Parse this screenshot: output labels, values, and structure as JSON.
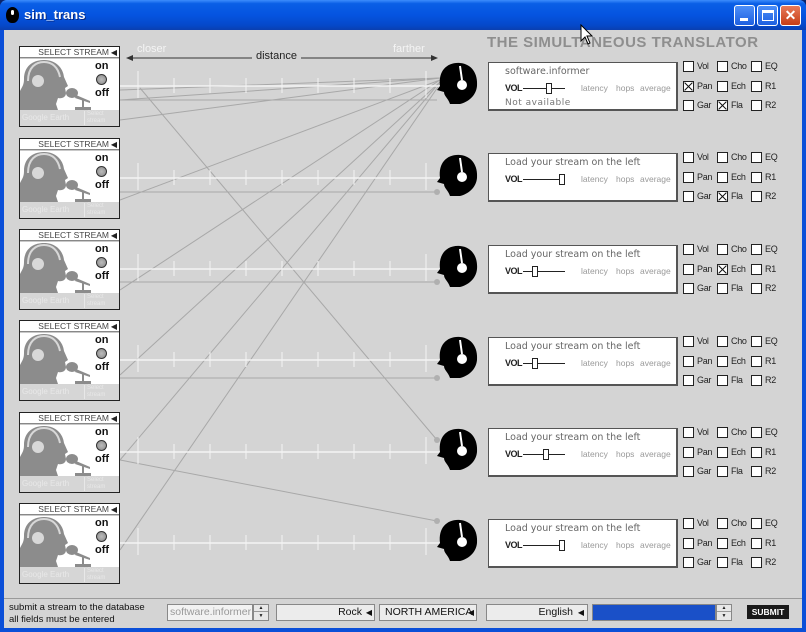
{
  "window": {
    "title": "sim_trans",
    "icon": "headphones-head-icon",
    "controls": [
      "minimize",
      "maximize",
      "close"
    ]
  },
  "header": {
    "brand": "THE SIMULTANEOUS TRANSLATOR",
    "distance_label": "distance",
    "closer_label": "closer",
    "farther_label": "farther"
  },
  "streams": [
    {
      "select_label": "SELECT STREAM",
      "on_label": "on",
      "off_label": "off",
      "footer_label": "Google Earth",
      "footer_sub": "Select stream"
    },
    {
      "select_label": "SELECT STREAM",
      "on_label": "on",
      "off_label": "off",
      "footer_label": "Google Earth",
      "footer_sub": "Select stream"
    },
    {
      "select_label": "SELECT STREAM",
      "on_label": "on",
      "off_label": "off",
      "footer_label": "Google Earth",
      "footer_sub": "Select stream"
    },
    {
      "select_label": "SELECT STREAM",
      "on_label": "on",
      "off_label": "off",
      "footer_label": "Google Earth",
      "footer_sub": "Select stream"
    },
    {
      "select_label": "SELECT STREAM",
      "on_label": "on",
      "off_label": "off",
      "footer_label": "Google Earth",
      "footer_sub": "Select stream"
    },
    {
      "select_label": "SELECT STREAM",
      "on_label": "on",
      "off_label": "off",
      "footer_label": "Google Earth",
      "footer_sub": "Select stream"
    }
  ],
  "listeners": [
    {
      "message": "software.informer",
      "vol_label": "VOL",
      "volume": 0.65,
      "latency": "latency",
      "hops": "hops",
      "average": "average",
      "status": "Not available",
      "effects": [
        [
          "Vol",
          false
        ],
        [
          "Cho",
          false
        ],
        [
          "EQ",
          false
        ],
        [
          "Pan",
          true
        ],
        [
          "Ech",
          false
        ],
        [
          "R1",
          false
        ],
        [
          "Gar",
          false
        ],
        [
          "Fla",
          true
        ],
        [
          "R2",
          false
        ]
      ]
    },
    {
      "message": "Load your stream on the left",
      "vol_label": "VOL",
      "volume": 1.0,
      "latency": "latency",
      "hops": "hops",
      "average": "average",
      "status": "",
      "effects": [
        [
          "Vol",
          false
        ],
        [
          "Cho",
          false
        ],
        [
          "EQ",
          false
        ],
        [
          "Pan",
          false
        ],
        [
          "Ech",
          false
        ],
        [
          "R1",
          false
        ],
        [
          "Gar",
          false
        ],
        [
          "Fla",
          true
        ],
        [
          "R2",
          false
        ]
      ]
    },
    {
      "message": "Load your stream on the left",
      "vol_label": "VOL",
      "volume": 0.25,
      "latency": "latency",
      "hops": "hops",
      "average": "average",
      "status": "",
      "effects": [
        [
          "Vol",
          false
        ],
        [
          "Cho",
          false
        ],
        [
          "EQ",
          false
        ],
        [
          "Pan",
          false
        ],
        [
          "Ech",
          true
        ],
        [
          "R1",
          false
        ],
        [
          "Gar",
          false
        ],
        [
          "Fla",
          false
        ],
        [
          "R2",
          false
        ]
      ]
    },
    {
      "message": "Load your stream on the left",
      "vol_label": "VOL",
      "volume": 0.25,
      "latency": "latency",
      "hops": "hops",
      "average": "average",
      "status": "",
      "effects": [
        [
          "Vol",
          false
        ],
        [
          "Cho",
          false
        ],
        [
          "EQ",
          false
        ],
        [
          "Pan",
          false
        ],
        [
          "Ech",
          false
        ],
        [
          "R1",
          false
        ],
        [
          "Gar",
          false
        ],
        [
          "Fla",
          false
        ],
        [
          "R2",
          false
        ]
      ]
    },
    {
      "message": "Load your stream on the left",
      "vol_label": "VOL",
      "volume": 0.55,
      "latency": "latency",
      "hops": "hops",
      "average": "average",
      "status": "",
      "effects": [
        [
          "Vol",
          false
        ],
        [
          "Cho",
          false
        ],
        [
          "EQ",
          false
        ],
        [
          "Pan",
          false
        ],
        [
          "Ech",
          false
        ],
        [
          "R1",
          false
        ],
        [
          "Gar",
          false
        ],
        [
          "Fla",
          false
        ],
        [
          "R2",
          false
        ]
      ]
    },
    {
      "message": "Load your stream on the left",
      "vol_label": "VOL",
      "volume": 1.0,
      "latency": "latency",
      "hops": "hops",
      "average": "average",
      "status": "",
      "effects": [
        [
          "Vol",
          false
        ],
        [
          "Cho",
          false
        ],
        [
          "EQ",
          false
        ],
        [
          "Pan",
          false
        ],
        [
          "Ech",
          false
        ],
        [
          "R1",
          false
        ],
        [
          "Gar",
          false
        ],
        [
          "Fla",
          false
        ],
        [
          "R2",
          false
        ]
      ]
    }
  ],
  "footer": {
    "line1": "submit a stream to the database",
    "line2": "all fields must be entered",
    "stream_name": "software.informer",
    "genre": "Rock",
    "region": "NORTH AMERICA",
    "language": "English",
    "submit_label": "SUBMIT"
  },
  "colors": {
    "titlebar": "#0554e0",
    "client_bg": "#d4d4d4",
    "brand_text": "#8e8e8e",
    "selection_blue": "#1a50c8"
  }
}
